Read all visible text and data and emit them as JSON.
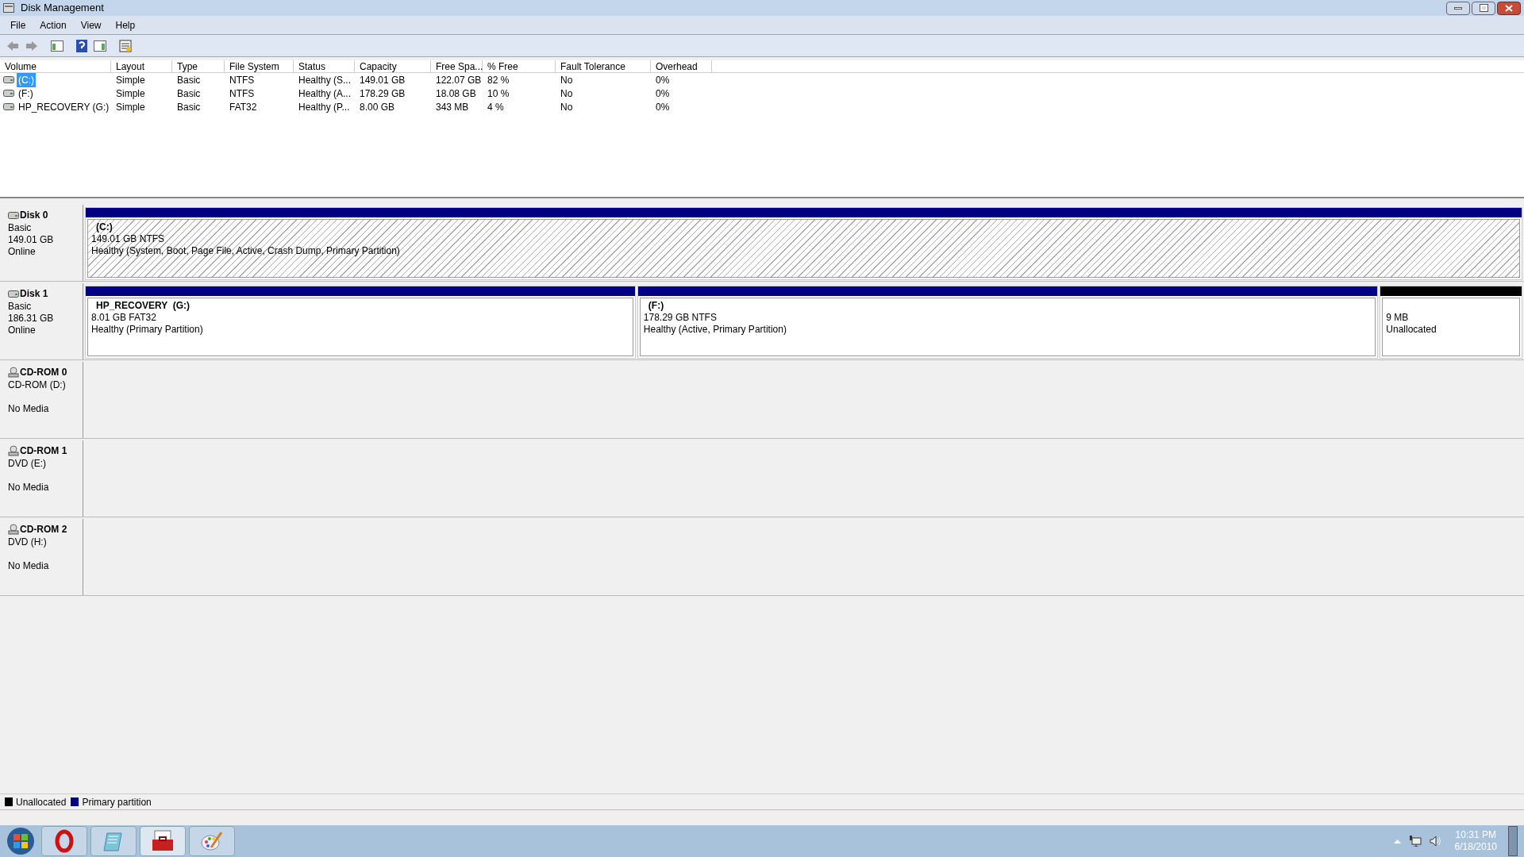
{
  "window": {
    "title": "Disk Management"
  },
  "menu": [
    "File",
    "Action",
    "View",
    "Help"
  ],
  "table": {
    "columns": [
      "Volume",
      "Layout",
      "Type",
      "File System",
      "Status",
      "Capacity",
      "Free Spa...",
      "% Free",
      "Fault Tolerance",
      "Overhead"
    ],
    "rows": [
      {
        "selected": true,
        "cells": [
          "(C:)",
          "Simple",
          "Basic",
          "NTFS",
          "Healthy (S...",
          "149.01 GB",
          "122.07 GB",
          "82 %",
          "No",
          "0%"
        ]
      },
      {
        "selected": false,
        "cells": [
          "(F:)",
          "Simple",
          "Basic",
          "NTFS",
          "Healthy (A...",
          "178.29 GB",
          "18.08 GB",
          "10 %",
          "No",
          "0%"
        ]
      },
      {
        "selected": false,
        "cells": [
          "HP_RECOVERY (G:)",
          "Simple",
          "Basic",
          "FAT32",
          "Healthy (P...",
          "8.00 GB",
          "343 MB",
          "4 %",
          "No",
          "0%"
        ]
      }
    ]
  },
  "disks": [
    {
      "kind": "disk",
      "name": "Disk 0",
      "lines": [
        "Basic",
        "149.01 GB",
        "Online"
      ],
      "partitions": [
        {
          "kind": "primary",
          "selected": true,
          "title": "(C:)",
          "lines": [
            "149.01 GB NTFS",
            "Healthy (System, Boot, Page File, Active, Crash Dump, Primary Partition)"
          ]
        }
      ]
    },
    {
      "kind": "disk",
      "name": "Disk 1",
      "lines": [
        "Basic",
        "186.31 GB",
        "Online"
      ],
      "partitions": [
        {
          "kind": "primary",
          "selected": false,
          "title": "HP_RECOVERY  (G:)",
          "lines": [
            "8.01 GB FAT32",
            "Healthy (Primary Partition)"
          ]
        },
        {
          "kind": "primary",
          "selected": false,
          "title": "(F:)",
          "lines": [
            "178.29 GB NTFS",
            "Healthy (Active, Primary Partition)"
          ]
        },
        {
          "kind": "unallocated",
          "selected": false,
          "lines": [
            "9 MB",
            "Unallocated"
          ]
        }
      ]
    },
    {
      "kind": "cdrom",
      "name": "CD-ROM 0",
      "lines": [
        "CD-ROM (D:)"
      ],
      "media": "No Media"
    },
    {
      "kind": "cdrom",
      "name": "CD-ROM 1",
      "lines": [
        "DVD (E:)"
      ],
      "media": "No Media"
    },
    {
      "kind": "cdrom",
      "name": "CD-ROM 2",
      "lines": [
        "DVD (H:)"
      ],
      "media": "No Media"
    }
  ],
  "legend": [
    {
      "kind": "unallocated",
      "label": "Unallocated"
    },
    {
      "kind": "primary",
      "label": "Primary partition"
    }
  ],
  "clock": {
    "time": "10:31 PM",
    "date": "6/18/2010"
  }
}
